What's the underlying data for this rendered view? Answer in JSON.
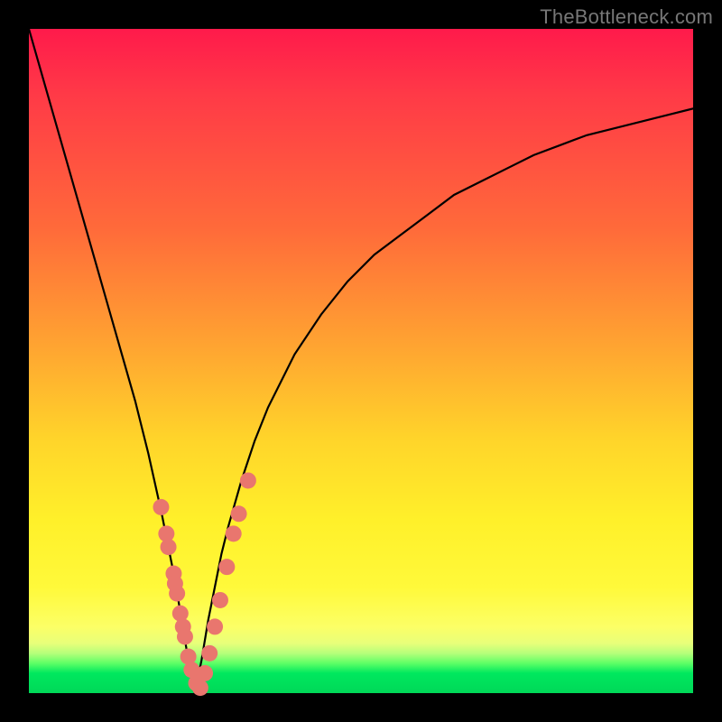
{
  "watermark": "TheBottleneck.com",
  "colors": {
    "page_bg": "#000000",
    "gradient_top": "#ff1a4b",
    "gradient_mid1": "#ff6a3a",
    "gradient_mid2": "#ffd52a",
    "gradient_low": "#fff93a",
    "gradient_green": "#00e85e",
    "curve": "#000000",
    "dots": "#e9766e"
  },
  "chart_data": {
    "type": "line",
    "title": "",
    "xlabel": "",
    "ylabel": "",
    "xlim": [
      0,
      100
    ],
    "ylim": [
      0,
      100
    ],
    "grid": false,
    "series": [
      {
        "name": "bottleneck-curve",
        "x": [
          0,
          2,
          4,
          6,
          8,
          10,
          12,
          14,
          16,
          18,
          20,
          21,
          22,
          23,
          24,
          25,
          26,
          27,
          28,
          29,
          30,
          32,
          34,
          36,
          38,
          40,
          44,
          48,
          52,
          56,
          60,
          64,
          68,
          72,
          76,
          80,
          84,
          88,
          92,
          96,
          100
        ],
        "y": [
          100,
          93,
          86,
          79,
          72,
          65,
          58,
          51,
          44,
          36,
          27,
          22,
          17,
          11,
          5,
          0,
          5,
          11,
          16,
          21,
          25,
          32,
          38,
          43,
          47,
          51,
          57,
          62,
          66,
          69,
          72,
          75,
          77,
          79,
          81,
          82.5,
          84,
          85,
          86,
          87,
          88
        ]
      }
    ],
    "points": [
      {
        "name": "dots-left",
        "x": [
          19.9,
          20.7,
          21.0,
          21.8,
          22.0,
          22.3,
          22.8,
          23.2,
          23.5,
          24.0,
          24.5,
          25.2,
          25.8
        ],
        "y": [
          28,
          24,
          22,
          18,
          16.5,
          15,
          12,
          10,
          8.5,
          5.5,
          3.5,
          1.5,
          0.8
        ]
      },
      {
        "name": "dots-right",
        "x": [
          26.5,
          27.2,
          28.0,
          28.8,
          29.8,
          30.8,
          31.6,
          33.0
        ],
        "y": [
          3,
          6,
          10,
          14,
          19,
          24,
          27,
          32
        ]
      }
    ],
    "annotations": []
  }
}
